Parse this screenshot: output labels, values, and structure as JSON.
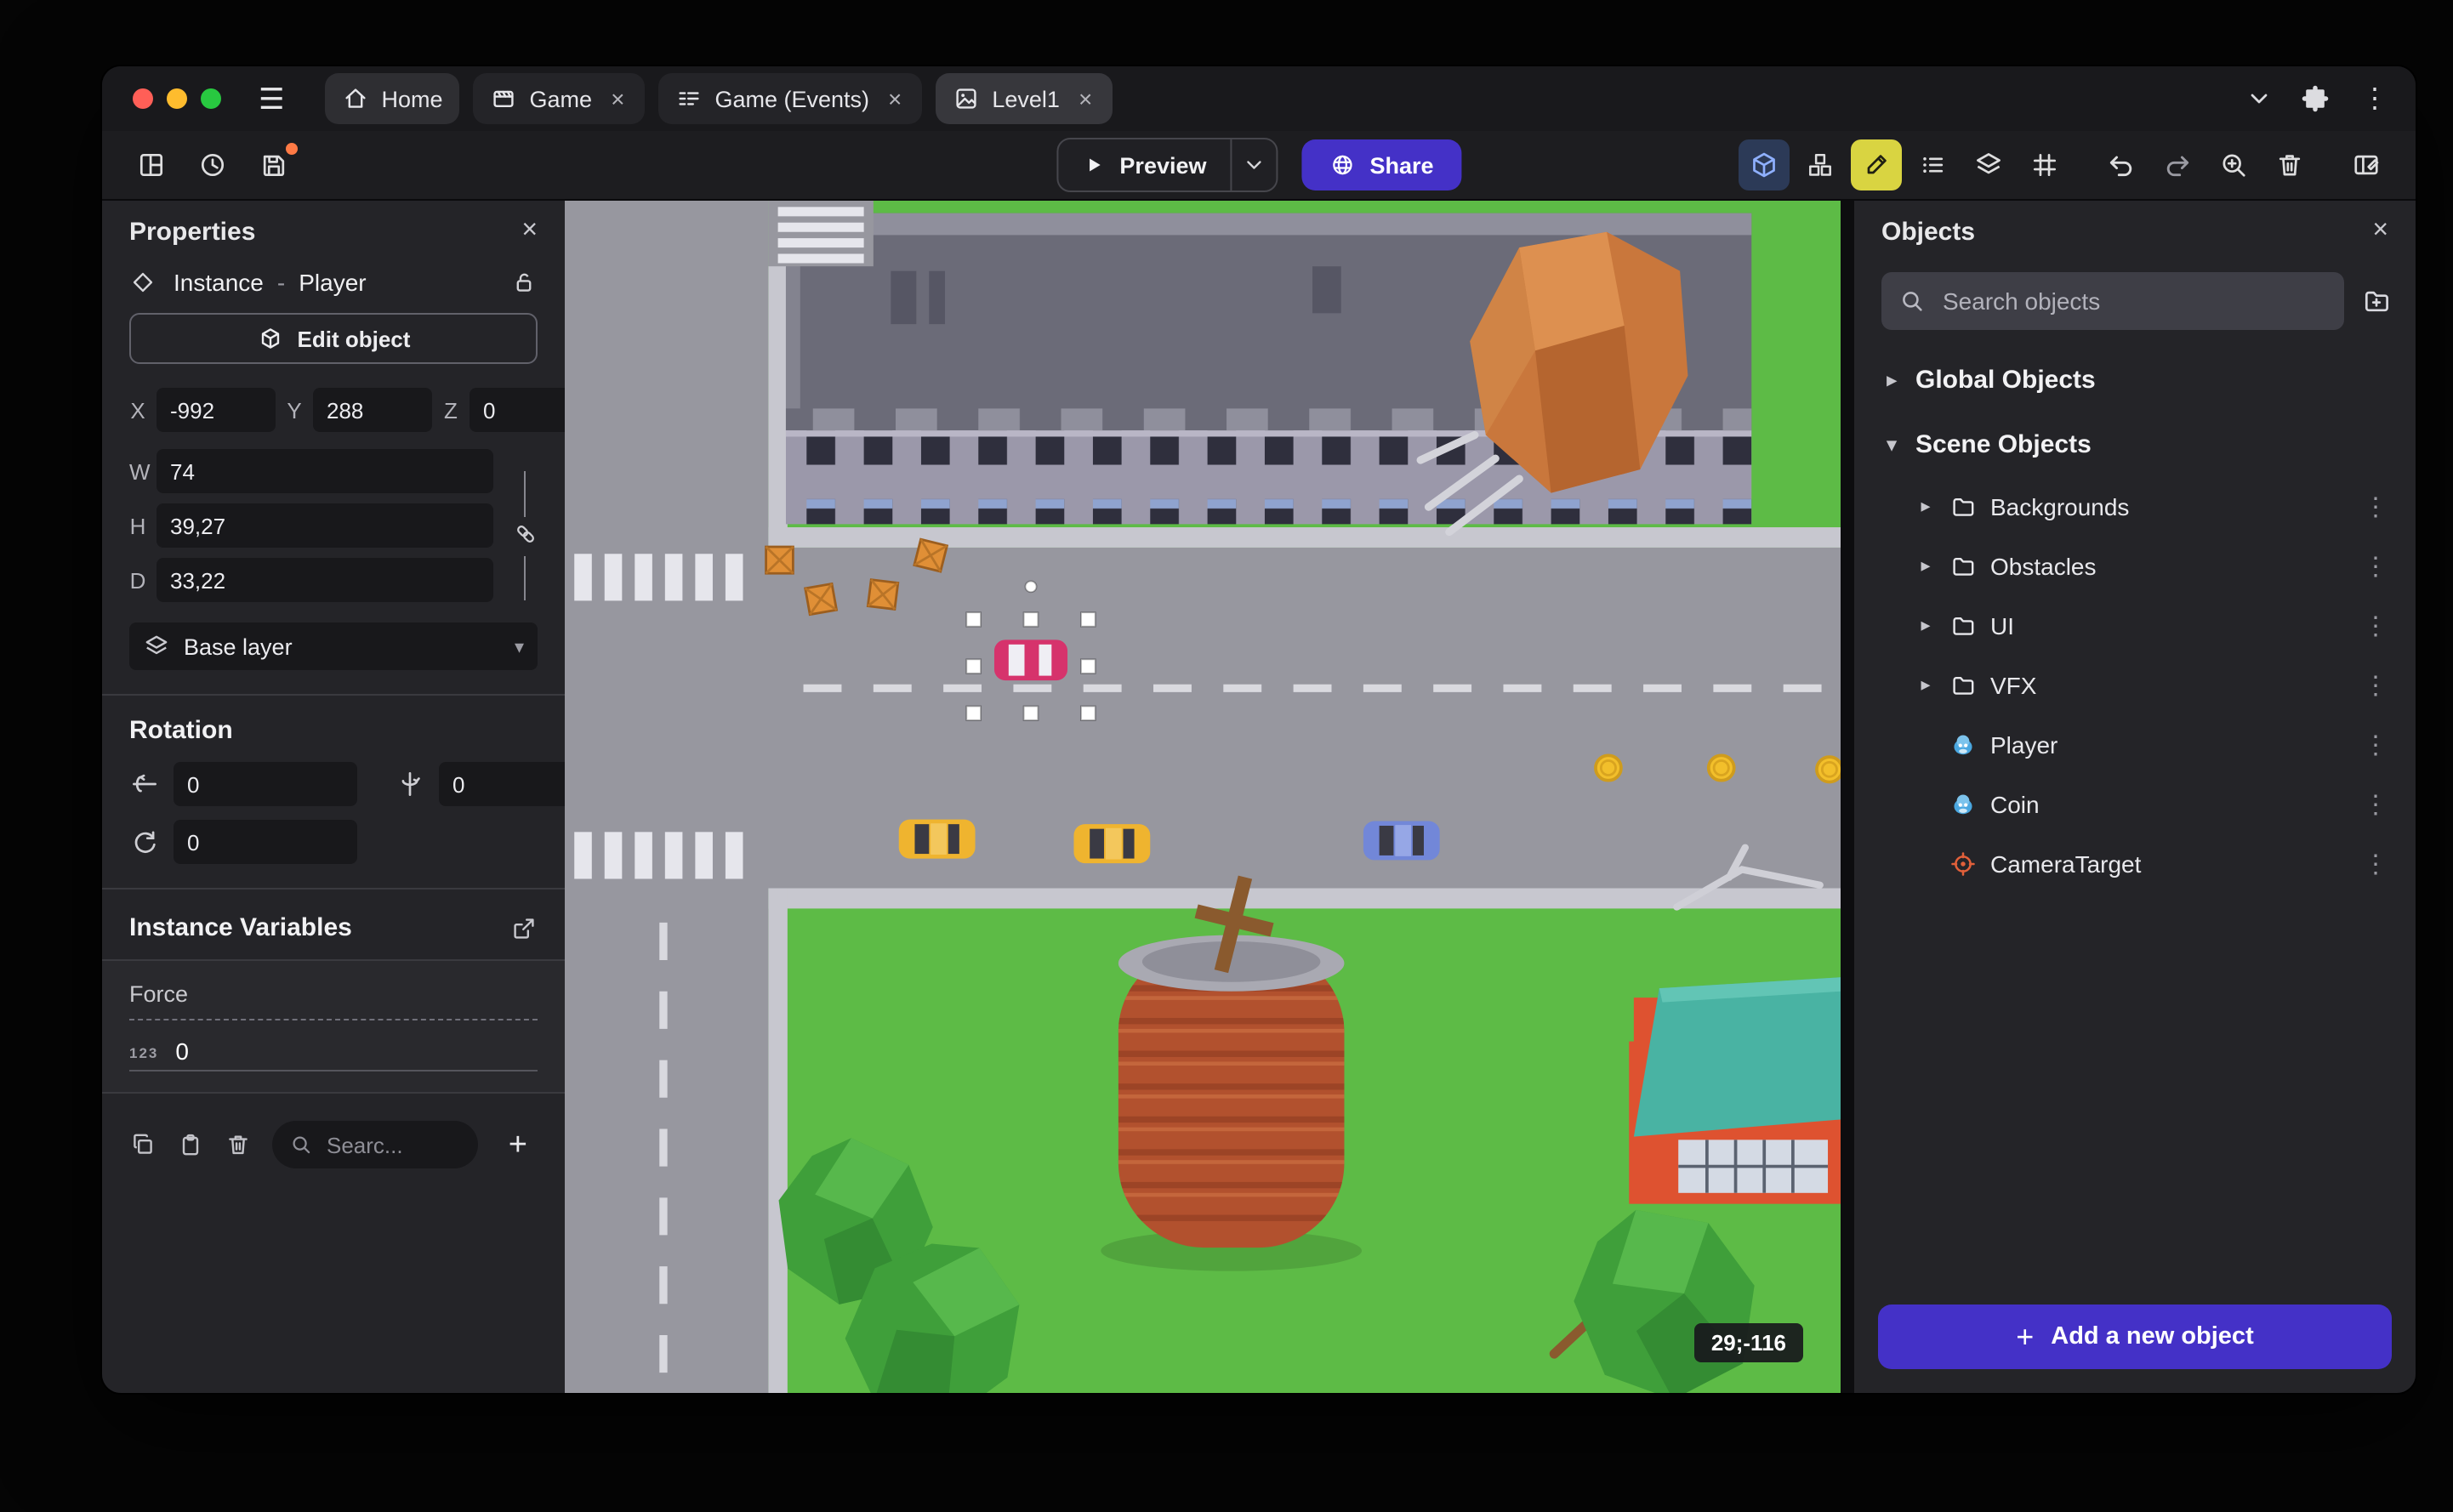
{
  "icons": {
    "hamburger": "☰",
    "kebab": "⋮",
    "close": "×",
    "plus": "+",
    "chevron_down": "▾",
    "chevron_right": "▸"
  },
  "colors": {
    "accent": "#4431c7",
    "panel_bg": "#242428",
    "canvas_road": "#97979f",
    "canvas_grass": "#5dbb46",
    "selection_pink": "#d6336c"
  },
  "window": {
    "tabs": [
      {
        "label": "Home"
      },
      {
        "label": "Game"
      },
      {
        "label": "Game (Events)"
      },
      {
        "label": "Level1"
      }
    ]
  },
  "toolbar": {
    "preview_label": "Preview",
    "share_label": "Share"
  },
  "properties": {
    "title": "Properties",
    "instance_label": "Instance",
    "separator": "-",
    "object_name": "Player",
    "edit_object_label": "Edit object",
    "x_label": "X",
    "x": "-992",
    "y_label": "Y",
    "y": "288",
    "z_label": "Z",
    "z": "0",
    "w_label": "W",
    "w": "74",
    "h_label": "H",
    "h": "39,27",
    "d_label": "D",
    "d": "33,22",
    "layer": "Base layer",
    "rotation_title": "Rotation",
    "rot_x": "0",
    "rot_y": "0",
    "rot_z": "0",
    "variables_title": "Instance Variables",
    "variable_name": "Force",
    "variable_type": "123",
    "variable_value": "0",
    "search_placeholder": "Searc..."
  },
  "canvas": {
    "coords_badge": "29;-116"
  },
  "objects_panel": {
    "title": "Objects",
    "search_placeholder": "Search objects",
    "groups": [
      {
        "label": "Global Objects"
      },
      {
        "label": "Scene Objects"
      }
    ],
    "folders": [
      {
        "label": "Backgrounds"
      },
      {
        "label": "Obstacles"
      },
      {
        "label": "UI"
      },
      {
        "label": "VFX"
      }
    ],
    "items": [
      {
        "label": "Player"
      },
      {
        "label": "Coin"
      },
      {
        "label": "CameraTarget"
      }
    ],
    "add_button": "Add a new object"
  }
}
